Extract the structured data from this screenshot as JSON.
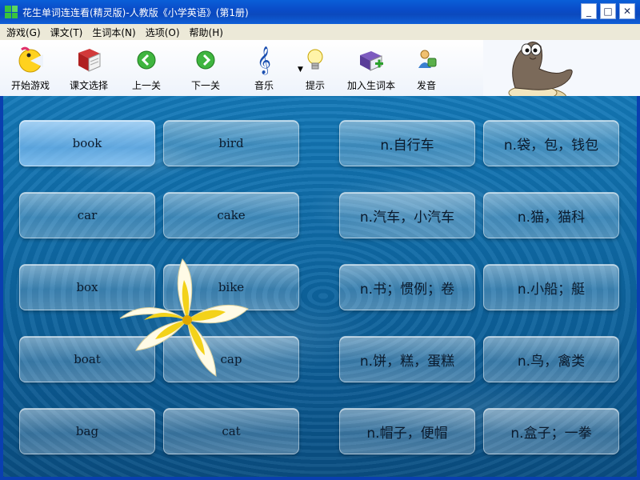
{
  "window": {
    "title": "花生单词连连看(精灵版)-人教版《小学英语》(第1册)",
    "minimize": "_",
    "maximize": "□",
    "close": "✕"
  },
  "menu": [
    "游戏(G)",
    "课文(T)",
    "生词本(N)",
    "选项(O)",
    "帮助(H)"
  ],
  "toolbar": {
    "start": "开始游戏",
    "lesson": "课文选择",
    "prev": "上一关",
    "next": "下一关",
    "music": "音乐",
    "hint": "提示",
    "add_word": "加入生词本",
    "pronounce": "发音",
    "dropdown_arrow": "▼"
  },
  "cards": {
    "col1": [
      "book",
      "car",
      "box",
      "boat",
      "bag"
    ],
    "col2": [
      "bird",
      "cake",
      "bike",
      "cap",
      "cat"
    ],
    "col3": [
      "n.自行车",
      "n.汽车，小汽车",
      "n.书；惯例；卷",
      "n.饼，糕，蛋糕",
      "n.帽子，便帽"
    ],
    "col4": [
      "n.袋，包，钱包",
      "n.猫，猫科",
      "n.小船；艇",
      "n.鸟，禽类",
      "n.盒子；一拳"
    ]
  },
  "colors": {
    "title_bar": "#0a4cc8",
    "water": "#0f6aa6",
    "selected_card": "#8cc8f5"
  }
}
